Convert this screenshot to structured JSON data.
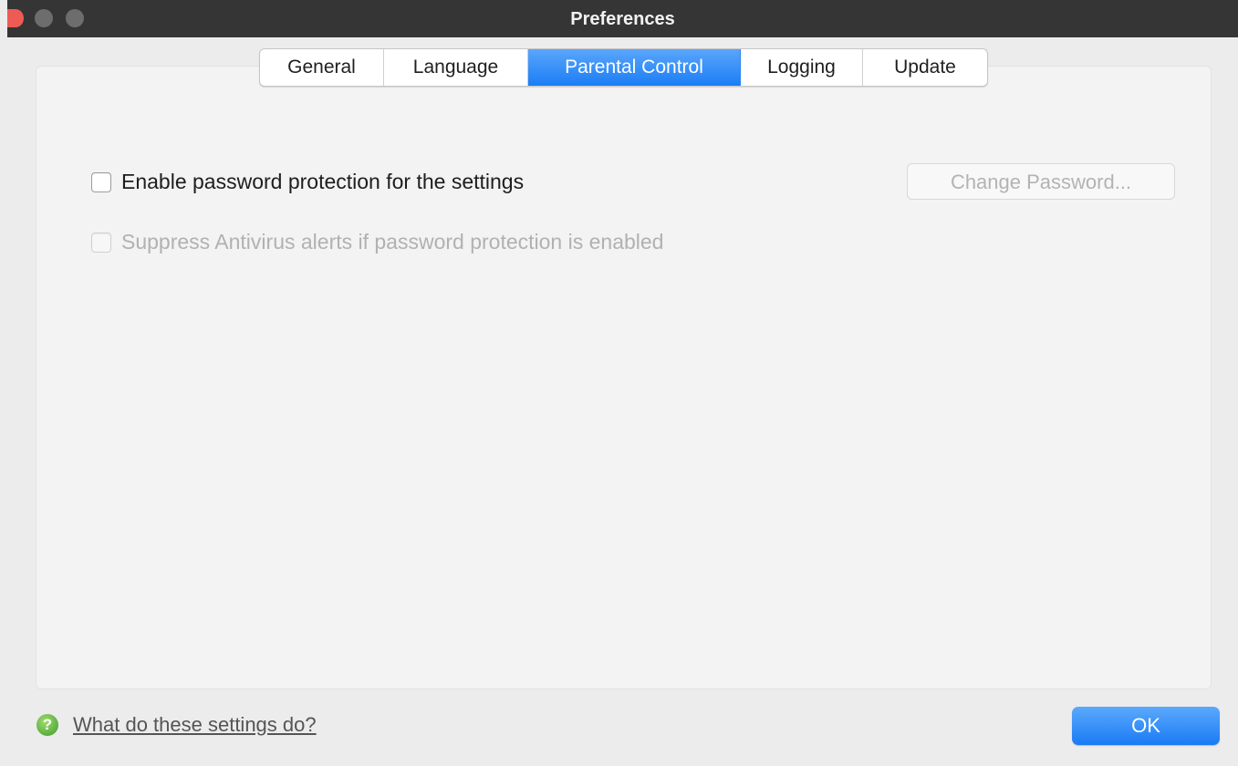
{
  "window": {
    "title": "Preferences"
  },
  "tabs": [
    {
      "label": "General",
      "active": false
    },
    {
      "label": "Language",
      "active": false
    },
    {
      "label": "Parental Control",
      "active": true
    },
    {
      "label": "Logging",
      "active": false
    },
    {
      "label": "Update",
      "active": false
    }
  ],
  "parental_control": {
    "password_protection": {
      "label": "Enable password protection for the settings",
      "checked": false,
      "enabled": true
    },
    "suppress_alerts": {
      "label": "Suppress Antivirus alerts if password protection is enabled",
      "checked": false,
      "enabled": false
    },
    "change_password_label": "Change Password...",
    "change_password_enabled": false
  },
  "footer": {
    "help_icon_glyph": "?",
    "help_link": "What do these settings do?",
    "ok_label": "OK"
  },
  "colors": {
    "accent": "#1b7df5",
    "close_button": "#ee5b54",
    "help_icon": "#3e9a2c"
  }
}
